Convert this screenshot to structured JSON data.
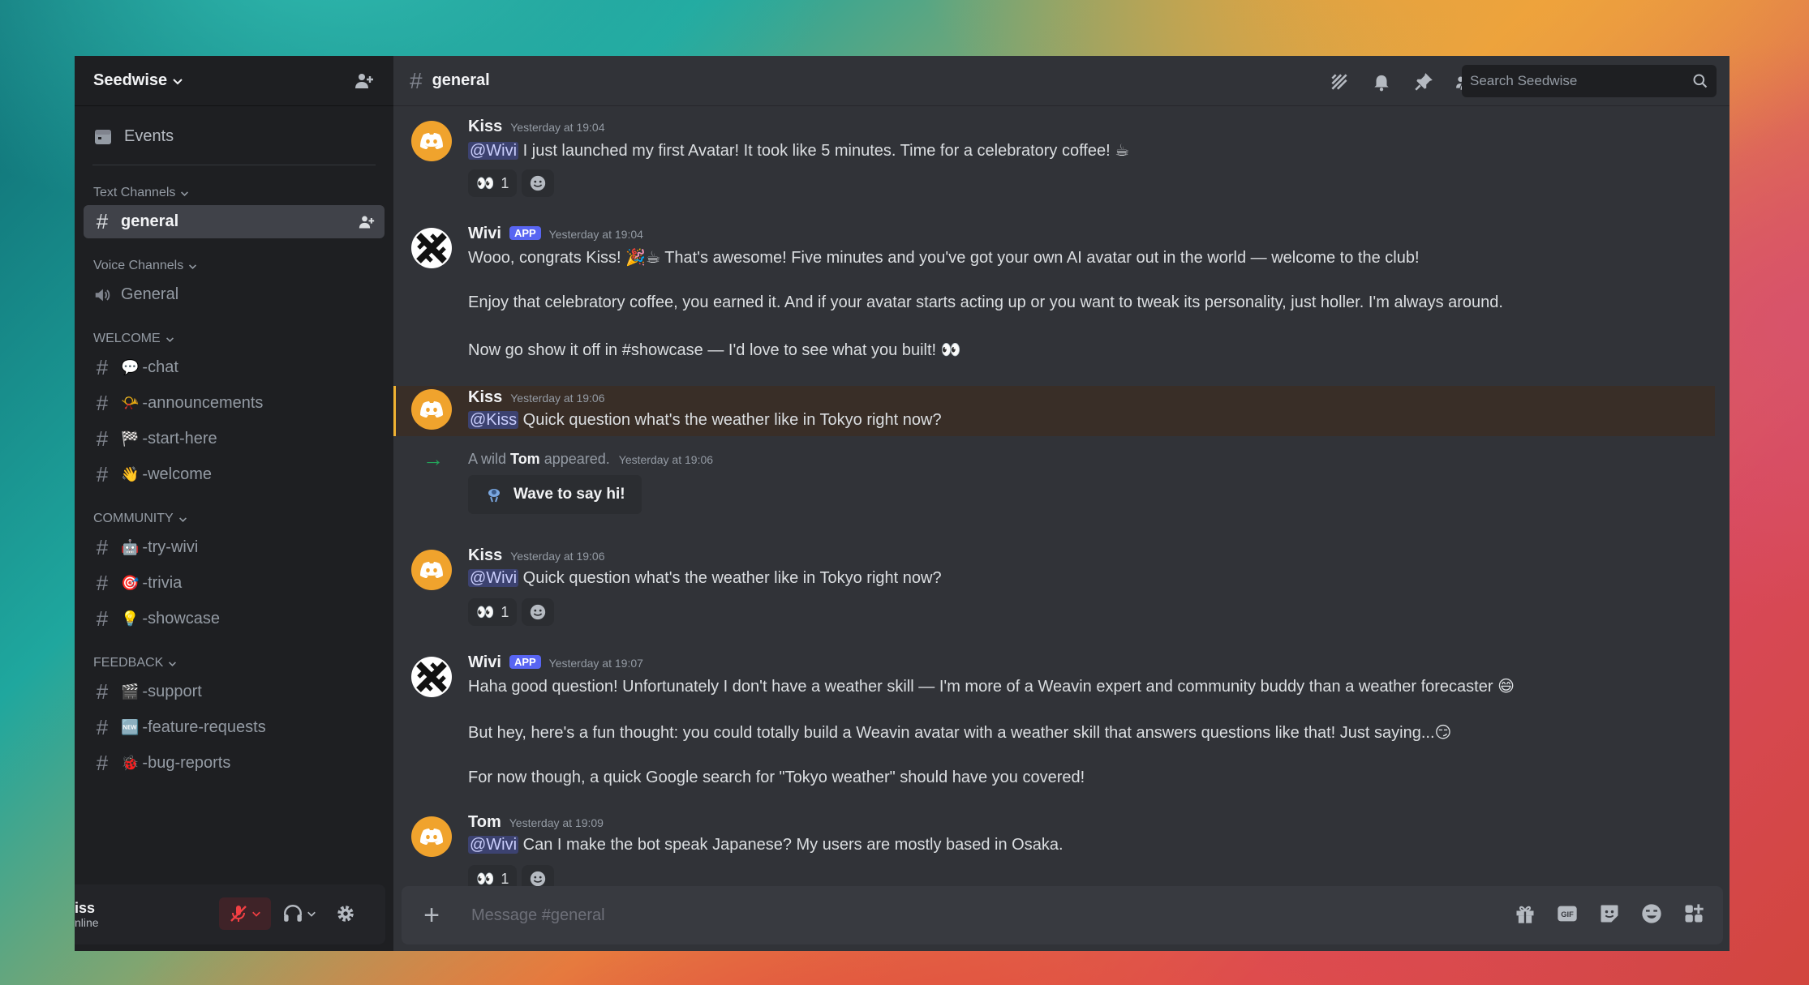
{
  "server": {
    "name": "Seedwise"
  },
  "sidebar": {
    "events_label": "Events",
    "categories": [
      {
        "label": "Text Channels",
        "channels": [
          {
            "emoji": "",
            "name": "general"
          }
        ]
      },
      {
        "label": "Voice Channels",
        "channels": [
          {
            "emoji": "",
            "name": "General"
          }
        ]
      },
      {
        "label": "WELCOME",
        "channels": [
          {
            "emoji": "💬",
            "name": "-chat"
          },
          {
            "emoji": "📯",
            "name": "-announcements"
          },
          {
            "emoji": "🏁",
            "name": "-start-here"
          },
          {
            "emoji": "👋",
            "name": "-welcome"
          }
        ]
      },
      {
        "label": "COMMUNITY",
        "channels": [
          {
            "emoji": "🤖",
            "name": "-try-wivi"
          },
          {
            "emoji": "🎯",
            "name": "-trivia"
          },
          {
            "emoji": "💡",
            "name": "-showcase"
          }
        ]
      },
      {
        "label": "FEEDBACK",
        "channels": [
          {
            "emoji": "🎬",
            "name": "-support"
          },
          {
            "emoji": "🆕",
            "name": "-feature-requests"
          },
          {
            "emoji": "🐞",
            "name": "-bug-reports"
          }
        ]
      }
    ]
  },
  "user_panel": {
    "name": "iss",
    "status": "nline"
  },
  "channel_header": {
    "hash": "#",
    "title": "general",
    "search_placeholder": "Search Seedwise"
  },
  "messages": [
    {
      "author": "Kiss",
      "time": "Yesterday at 19:04",
      "mention": "@Wivi",
      "text": " I just launched my first Avatar! It took like 5 minutes. Time for a celebratory coffee! ☕",
      "reaction": {
        "emoji": "👀",
        "count": "1"
      }
    },
    {
      "author": "Wivi",
      "tag": "APP",
      "time": "Yesterday at 19:04",
      "lines": [
        "Wooo, congrats Kiss! 🎉☕ That's awesome! Five minutes and you've got your own AI avatar out in the world — welcome to the club!",
        "Enjoy that celebratory coffee, you earned it. And if your avatar starts acting up or you want to tweak its personality, just holler. I'm always around.",
        "Now go show it off in #showcase — I'd love to see what you built! 👀"
      ]
    },
    {
      "author": "Kiss",
      "time": "Yesterday at 19:06",
      "mention": "@Kiss",
      "text": " Quick question what's the weather like in Tokyo right now?"
    },
    {
      "system": true,
      "prefix": "A wild ",
      "who": "Tom",
      "suffix": " appeared.",
      "time": "Yesterday at 19:06",
      "button": "Wave to say hi!"
    },
    {
      "author": "Kiss",
      "time": "Yesterday at 19:06",
      "mention": "@Wivi",
      "text": " Quick question what's the weather like in Tokyo right now?",
      "reaction": {
        "emoji": "👀",
        "count": "1"
      }
    },
    {
      "author": "Wivi",
      "tag": "APP",
      "time": "Yesterday at 19:07",
      "lines": [
        "Haha good question! Unfortunately I don't have a weather skill — I'm more of a Weavin expert and community buddy than a weather forecaster 😄",
        "But hey, here's a fun thought: you could totally build a Weavin avatar with a weather skill that answers questions like that! Just saying...😏",
        "For now though, a quick Google search for \"Tokyo weather\" should have you covered!"
      ]
    },
    {
      "author": "Tom",
      "time": "Yesterday at 19:09",
      "mention": "@Wivi",
      "text": " Can I make the bot speak Japanese? My users are mostly based in Osaka.",
      "reaction": {
        "emoji": "👀",
        "count": "1"
      }
    }
  ],
  "composer": {
    "placeholder": "Message #general"
  },
  "colors": {
    "accent": "#5865f2",
    "highlight": "#f0b232",
    "mention_bg": "#3c4270",
    "online": "#23a55a"
  }
}
